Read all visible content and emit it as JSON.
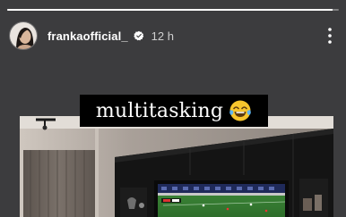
{
  "story": {
    "progress_fraction": 0.98
  },
  "header": {
    "username": "frankaofficial_",
    "time": "12 h",
    "verified": true,
    "more_icon": "more-vertical-icon"
  },
  "caption": {
    "text": "multitasking",
    "emoji": "face-with-tears-of-joy"
  },
  "photo": {
    "subject": "living-room-tv-wall"
  }
}
